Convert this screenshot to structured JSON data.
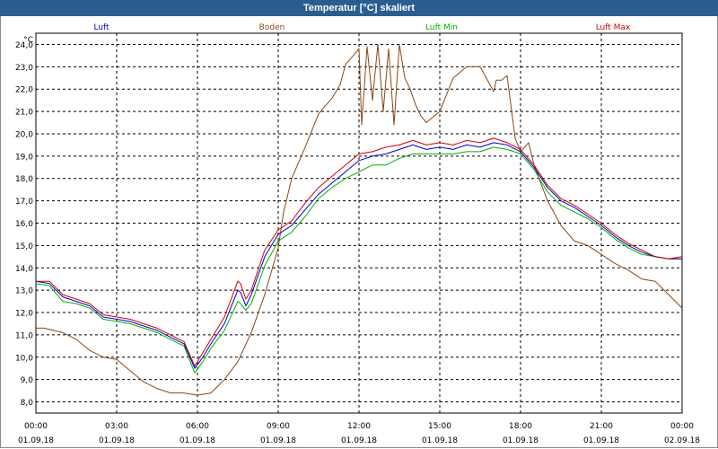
{
  "window": {
    "title": "Temperatur [°C] skaliert"
  },
  "chart_data": {
    "type": "line",
    "title": "Temperatur [°C] skaliert",
    "ylabel": "°C",
    "xlabel": "",
    "ylim": [
      7.5,
      24.5
    ],
    "xlim": [
      0,
      24
    ],
    "y_ticks": [
      "8,0",
      "9,0",
      "10,0",
      "11,0",
      "12,0",
      "13,0",
      "14,0",
      "15,0",
      "16,0",
      "17,0",
      "18,0",
      "19,0",
      "20,0",
      "21,0",
      "22,0",
      "23,0",
      "24,0"
    ],
    "x_ticks": [
      {
        "time": "00:00",
        "date": "01.09.18"
      },
      {
        "time": "03:00",
        "date": "01.09.18"
      },
      {
        "time": "06:00",
        "date": "01.09.18"
      },
      {
        "time": "09:00",
        "date": "01.09.18"
      },
      {
        "time": "12:00",
        "date": "01.09.18"
      },
      {
        "time": "15:00",
        "date": "01.09.18"
      },
      {
        "time": "18:00",
        "date": "01.09.18"
      },
      {
        "time": "21:00",
        "date": "01.09.18"
      },
      {
        "time": "00:00",
        "date": "02.09.18"
      }
    ],
    "grid": true,
    "legend_position": "top",
    "series": [
      {
        "name": "Luft",
        "color": "#0000cc",
        "x": [
          0,
          0.5,
          1,
          1.5,
          2,
          2.5,
          3,
          3.5,
          4,
          4.5,
          5,
          5.5,
          5.9,
          6.2,
          6.5,
          7,
          7.5,
          7.6,
          7.8,
          8,
          8.5,
          9,
          9.5,
          10,
          10.5,
          11,
          11.5,
          12,
          12.5,
          13,
          13.5,
          14,
          14.5,
          15,
          15.5,
          16,
          16.5,
          17,
          17.5,
          18,
          18.5,
          19,
          19.5,
          20,
          20.5,
          21,
          21.5,
          22,
          22.5,
          23,
          23.5,
          24
        ],
        "y": [
          13.4,
          13.3,
          12.7,
          12.5,
          12.3,
          11.8,
          11.7,
          11.6,
          11.4,
          11.2,
          10.9,
          10.6,
          9.5,
          10,
          10.6,
          11.5,
          13.0,
          12.9,
          12.3,
          12.8,
          14.5,
          15.5,
          15.9,
          16.6,
          17.3,
          17.8,
          18.3,
          18.8,
          19.0,
          19.1,
          19.3,
          19.5,
          19.3,
          19.4,
          19.3,
          19.5,
          19.4,
          19.6,
          19.5,
          19.2,
          18.5,
          17.6,
          17.0,
          16.7,
          16.3,
          15.9,
          15.4,
          15.0,
          14.7,
          14.5,
          14.4,
          14.4
        ]
      },
      {
        "name": "Boden",
        "color": "#8b4513",
        "x": [
          0,
          0.3,
          1,
          1.5,
          2,
          2.5,
          3,
          3.5,
          4,
          4.5,
          5,
          5.5,
          6,
          6.5,
          7,
          7.5,
          8,
          8.5,
          9,
          9.2,
          9.5,
          10,
          10.5,
          11,
          11.3,
          11.5,
          12,
          12.1,
          12.3,
          12.5,
          12.7,
          12.9,
          13.1,
          13.3,
          13.5,
          13.7,
          13.9,
          14.1,
          14.3,
          14.5,
          15,
          15.5,
          16,
          16.5,
          17,
          17.1,
          17.3,
          17.5,
          17.8,
          18,
          18.3,
          18.5,
          19,
          19.5,
          20,
          20.5,
          21,
          21.5,
          22,
          22.5,
          23,
          23.5,
          24
        ],
        "y": [
          11.3,
          11.3,
          11.1,
          10.8,
          10.3,
          10.0,
          9.9,
          9.4,
          8.9,
          8.6,
          8.4,
          8.4,
          8.3,
          8.4,
          9.0,
          9.8,
          11.1,
          12.8,
          14.9,
          16.5,
          18.0,
          19.4,
          20.9,
          21.6,
          22.2,
          23.1,
          23.8,
          20.4,
          23.9,
          21.5,
          24.0,
          21.0,
          23.8,
          20.4,
          24.0,
          22.5,
          22.0,
          21.3,
          20.8,
          20.5,
          21.0,
          22.5,
          23.0,
          23.0,
          21.9,
          22.4,
          22.4,
          22.6,
          19.8,
          19.2,
          19.6,
          18.6,
          17.0,
          15.9,
          15.2,
          15.0,
          14.6,
          14.2,
          13.9,
          13.5,
          13.4,
          12.8,
          12.2
        ]
      },
      {
        "name": "Luft Min",
        "color": "#00b000",
        "x": [
          0,
          0.5,
          1,
          1.5,
          2,
          2.5,
          3,
          3.5,
          4,
          4.5,
          5,
          5.5,
          5.9,
          6.2,
          6.5,
          7,
          7.5,
          7.6,
          7.8,
          8,
          8.5,
          9,
          9.5,
          10,
          10.5,
          11,
          11.5,
          12,
          12.5,
          13,
          13.5,
          14,
          14.5,
          15,
          15.5,
          16,
          16.5,
          17,
          17.5,
          18,
          18.5,
          19,
          19.5,
          20,
          20.5,
          21,
          21.5,
          22,
          22.5,
          23,
          23.5,
          24
        ],
        "y": [
          13.3,
          13.2,
          12.5,
          12.4,
          12.2,
          11.7,
          11.6,
          11.5,
          11.3,
          11.1,
          10.8,
          10.5,
          9.3,
          9.8,
          10.4,
          11.2,
          12.5,
          12.4,
          12.1,
          12.4,
          14.1,
          15.2,
          15.6,
          16.3,
          17.1,
          17.6,
          18.0,
          18.3,
          18.6,
          18.6,
          18.9,
          19.1,
          19.1,
          19.1,
          19.1,
          19.2,
          19.2,
          19.4,
          19.3,
          19.1,
          18.4,
          17.4,
          16.8,
          16.5,
          16.2,
          15.8,
          15.3,
          14.9,
          14.6,
          14.5,
          14.4,
          14.4
        ]
      },
      {
        "name": "Luft Max",
        "color": "#cc0000",
        "x": [
          0,
          0.5,
          1,
          1.5,
          2,
          2.5,
          3,
          3.5,
          4,
          4.5,
          5,
          5.5,
          5.9,
          6.2,
          6.5,
          7,
          7.5,
          7.6,
          7.8,
          8,
          8.5,
          9,
          9.5,
          10,
          10.5,
          11,
          11.5,
          12,
          12.5,
          13,
          13.5,
          14,
          14.5,
          15,
          15.5,
          16,
          16.5,
          17,
          17.5,
          18,
          18.5,
          19,
          19.5,
          20,
          20.5,
          21,
          21.5,
          22,
          22.5,
          23,
          23.5,
          24
        ],
        "y": [
          13.4,
          13.4,
          12.8,
          12.6,
          12.4,
          11.9,
          11.8,
          11.7,
          11.5,
          11.3,
          11.0,
          10.7,
          9.6,
          10.2,
          10.8,
          11.8,
          13.4,
          13.3,
          12.6,
          13.0,
          14.8,
          15.7,
          16.1,
          16.9,
          17.6,
          18.1,
          18.6,
          19.1,
          19.2,
          19.4,
          19.5,
          19.7,
          19.5,
          19.6,
          19.5,
          19.7,
          19.6,
          19.8,
          19.6,
          19.3,
          18.6,
          17.7,
          17.1,
          16.8,
          16.4,
          16.0,
          15.5,
          15.1,
          14.8,
          14.5,
          14.4,
          14.5
        ]
      }
    ]
  }
}
